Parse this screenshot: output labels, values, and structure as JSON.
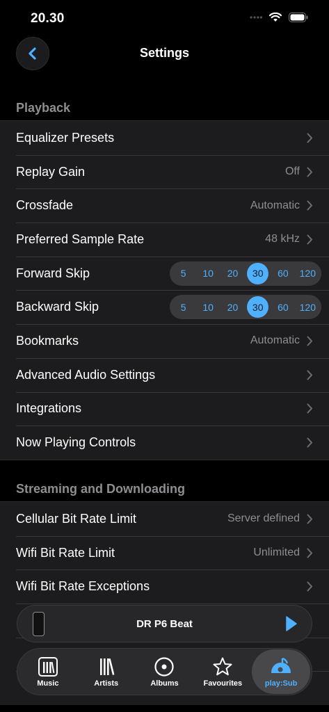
{
  "status": {
    "time": "20.30"
  },
  "nav": {
    "title": "Settings"
  },
  "sections": {
    "playback": {
      "header": "Playback",
      "rows": [
        {
          "label": "Equalizer Presets",
          "value": ""
        },
        {
          "label": "Replay Gain",
          "value": "Off"
        },
        {
          "label": "Crossfade",
          "value": "Automatic"
        },
        {
          "label": "Preferred Sample Rate",
          "value": "48 kHz"
        },
        {
          "label": "Forward Skip",
          "options": [
            "5",
            "10",
            "20",
            "30",
            "60",
            "120"
          ],
          "selected": "30"
        },
        {
          "label": "Backward Skip",
          "options": [
            "5",
            "10",
            "20",
            "30",
            "60",
            "120"
          ],
          "selected": "30"
        },
        {
          "label": "Bookmarks",
          "value": "Automatic"
        },
        {
          "label": "Advanced Audio Settings",
          "value": ""
        },
        {
          "label": "Integrations",
          "value": ""
        },
        {
          "label": "Now Playing Controls",
          "value": ""
        }
      ]
    },
    "streaming": {
      "header": "Streaming and Downloading",
      "rows": [
        {
          "label": "Cellular Bit Rate Limit",
          "value": "Server defined"
        },
        {
          "label": "Wifi Bit Rate Limit",
          "value": "Unlimited"
        },
        {
          "label": "Wifi Bit Rate Exceptions",
          "value": ""
        }
      ]
    }
  },
  "mini_player": {
    "title": "DR P6 Beat"
  },
  "tabs": [
    {
      "label": "Music",
      "icon": "music-library-icon",
      "active": false
    },
    {
      "label": "Artists",
      "icon": "artists-icon",
      "active": false
    },
    {
      "label": "Albums",
      "icon": "album-disc-icon",
      "active": false
    },
    {
      "label": "Favourites",
      "icon": "star-icon",
      "active": false
    },
    {
      "label": "play:Sub",
      "icon": "playsub-logo-icon",
      "active": true
    }
  ],
  "colors": {
    "accent": "#4fb0ff",
    "background": "#000000",
    "cell": "#1c1c1e",
    "secondary_text": "#8e8e93"
  }
}
